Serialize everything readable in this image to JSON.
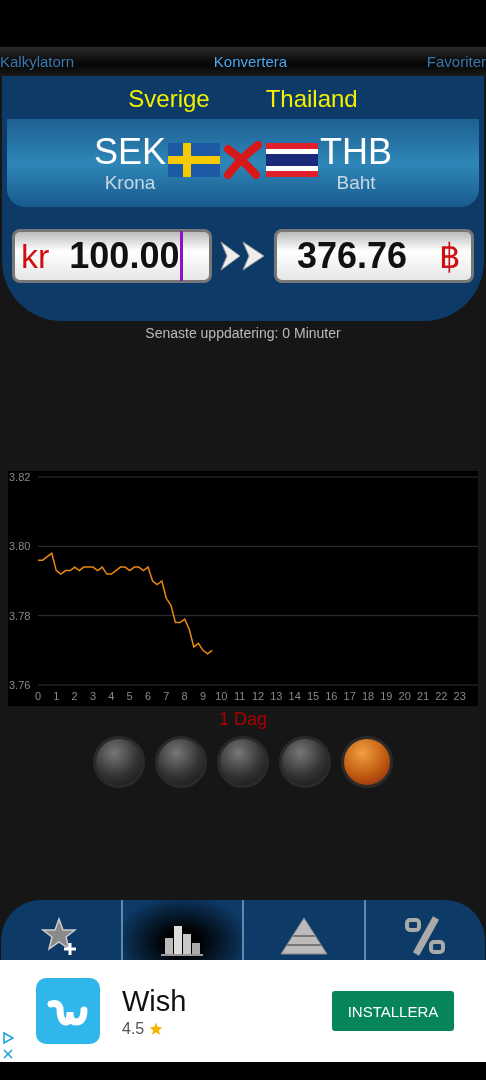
{
  "tabs": [
    {
      "label": "Kalkylatorn",
      "selected": false
    },
    {
      "label": "Konvertera",
      "selected": true
    },
    {
      "label": "Favoriter",
      "selected": false
    }
  ],
  "countries": [
    "Sverige",
    "Thailand"
  ],
  "from_currency": {
    "code": "SEK",
    "name": "Krona"
  },
  "to_currency": {
    "code": "THB",
    "name": "Baht"
  },
  "amount": {
    "symbol": "kr",
    "value": "100.00"
  },
  "result": {
    "symbol": "฿",
    "value": "376.76"
  },
  "last_update": "Senaste uppdatering: 0 Minuter",
  "chart": {
    "chart_data": {
      "type": "line",
      "xlim": [
        0,
        24
      ],
      "ylim": [
        3.76,
        3.82
      ],
      "xticks": [
        0,
        1,
        2,
        3,
        4,
        5,
        6,
        7,
        8,
        9,
        10,
        11,
        12,
        13,
        14,
        15,
        16,
        17,
        18,
        19,
        20,
        21,
        22,
        23
      ],
      "yticks": [
        {
          "value": 3.76,
          "label": "3.76"
        },
        {
          "value": 3.78,
          "label": "3.78"
        },
        {
          "value": 3.8,
          "label": "3.80"
        },
        {
          "value": 3.82,
          "label": "3.82"
        }
      ],
      "x": [
        0,
        0.25,
        0.5,
        0.75,
        1,
        1.25,
        1.5,
        1.75,
        2,
        2.25,
        2.5,
        2.75,
        3,
        3.25,
        3.5,
        3.75,
        4,
        4.25,
        4.5,
        4.75,
        5,
        5.25,
        5.5,
        5.75,
        6,
        6.25,
        6.5,
        6.75,
        7,
        7.25,
        7.5,
        7.75,
        8,
        8.25,
        8.5,
        8.75,
        9,
        9.25,
        9.5
      ],
      "series": [
        {
          "color": "#e88a10",
          "values": [
            3.796,
            3.796,
            3.797,
            3.798,
            3.793,
            3.792,
            3.793,
            3.793,
            3.794,
            3.793,
            3.794,
            3.794,
            3.794,
            3.793,
            3.794,
            3.792,
            3.792,
            3.793,
            3.794,
            3.794,
            3.793,
            3.794,
            3.794,
            3.793,
            3.794,
            3.79,
            3.789,
            3.79,
            3.785,
            3.783,
            3.778,
            3.778,
            3.779,
            3.776,
            3.771,
            3.772,
            3.77,
            3.769,
            3.77
          ]
        }
      ]
    }
  },
  "period_label": "1 Dag",
  "range_buttons": [
    {
      "selected": false
    },
    {
      "selected": false
    },
    {
      "selected": false
    },
    {
      "selected": false
    },
    {
      "selected": true
    }
  ],
  "toolbar": [
    {
      "kind": "favorite-add",
      "selected": false
    },
    {
      "kind": "chart",
      "selected": true
    },
    {
      "kind": "pyramid",
      "selected": false
    },
    {
      "kind": "percent",
      "selected": false
    }
  ],
  "ad": {
    "app_name": "Wish",
    "rating": "4.5",
    "button": "INSTALLERA"
  }
}
